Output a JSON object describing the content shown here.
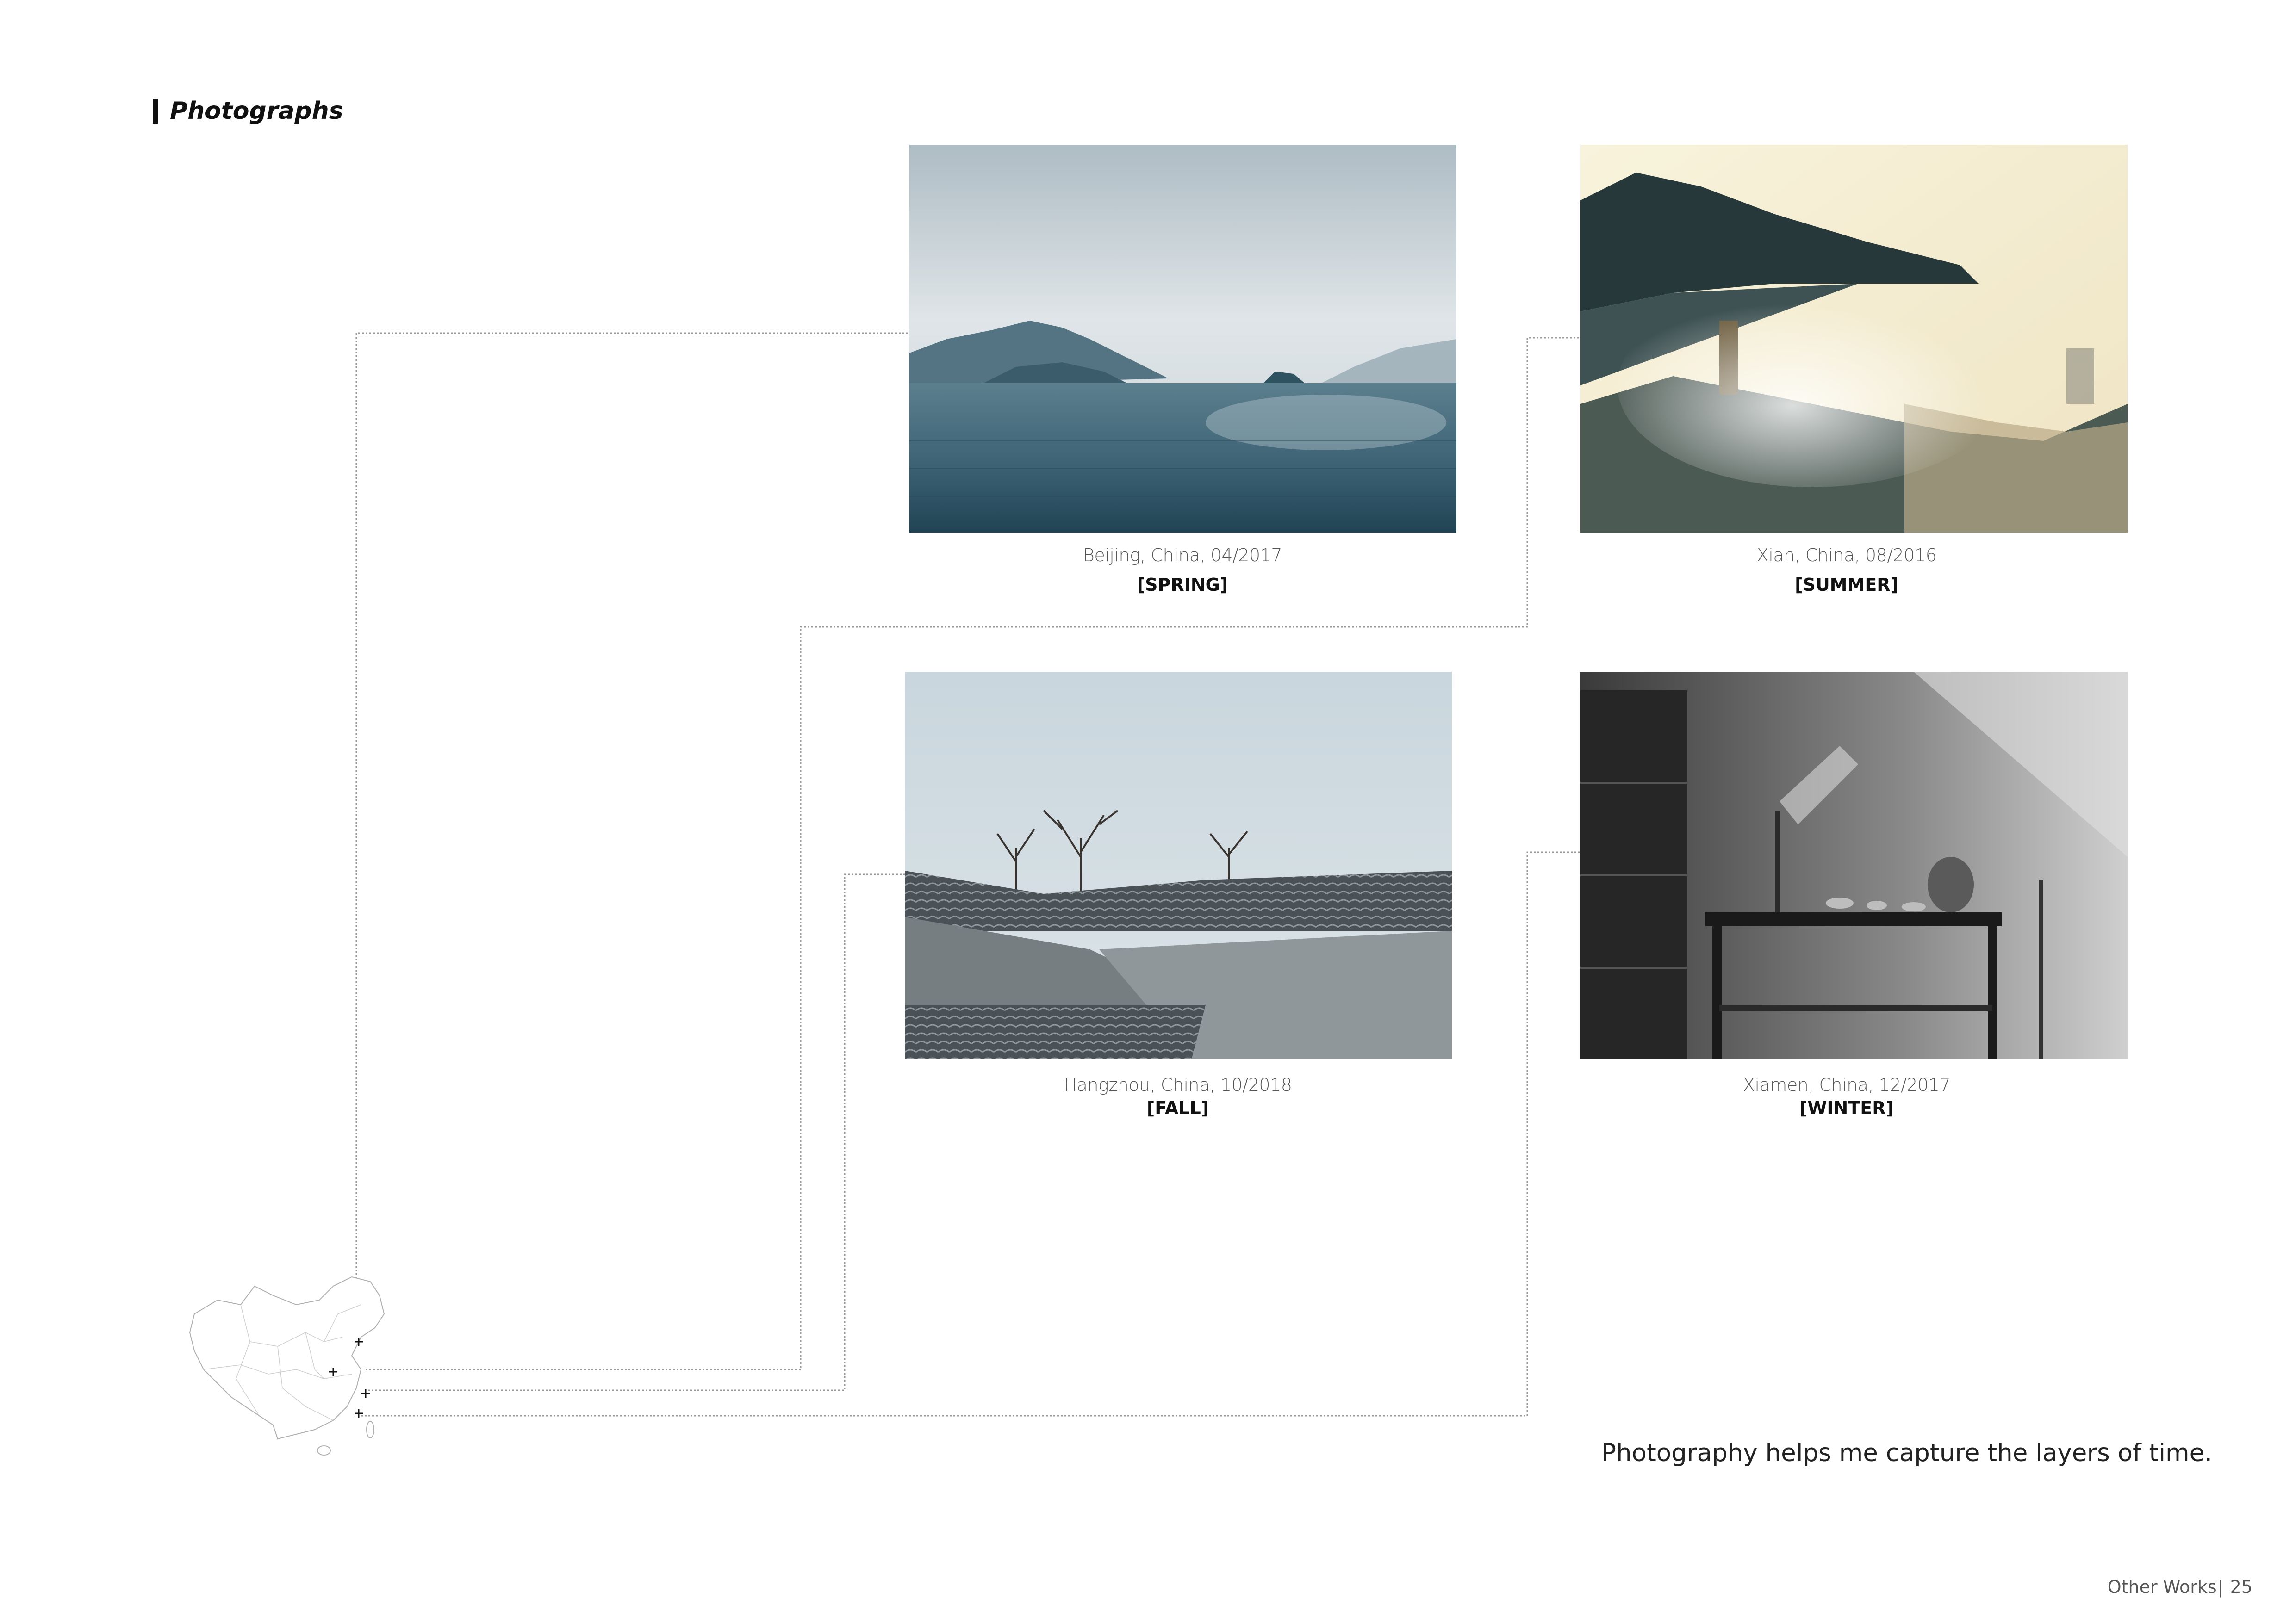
{
  "section": {
    "title": "Photographs"
  },
  "photos": [
    {
      "id": "spring",
      "place": "Beijing, China, 04/2017",
      "season": "[SPRING]"
    },
    {
      "id": "summer",
      "place": "Xian, China, 08/2016",
      "season": "[SUMMER]"
    },
    {
      "id": "fall",
      "place": "Hangzhou, China, 10/2018",
      "season": "[FALL]"
    },
    {
      "id": "winter",
      "place": "Xiamen, China, 12/2017",
      "season": "[WINTER]"
    }
  ],
  "quote": "Photography helps me capture the layers of time.",
  "footer": {
    "section": "Other Works",
    "separator": "|",
    "page": "25"
  },
  "colors": {
    "text": "#111111",
    "caption": "#555555",
    "connector": "#9a9a9a"
  },
  "icons": {
    "section_marker": "vertical-bar-marker",
    "map": "china-map-icon",
    "location": "plus-marker-icon"
  }
}
